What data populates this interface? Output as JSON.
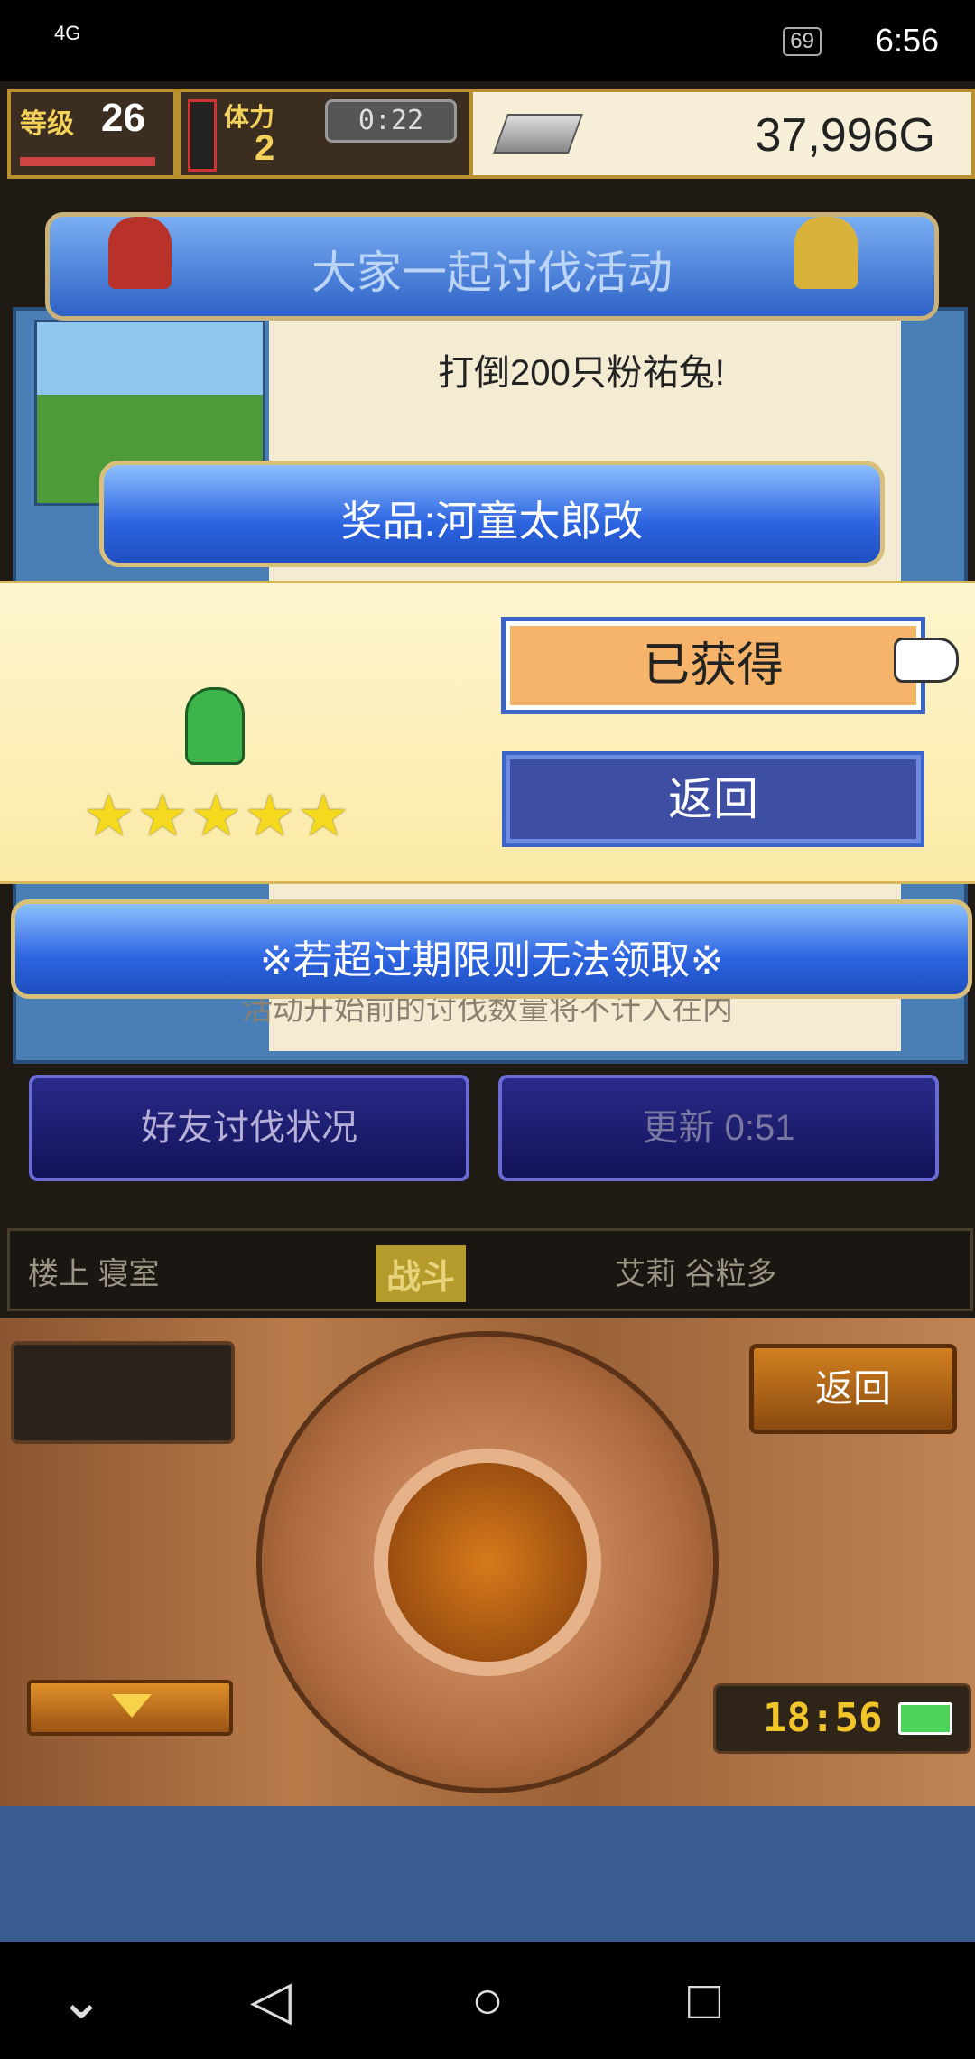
{
  "status_bar": {
    "network": "4G",
    "battery": "69",
    "time": "6:56"
  },
  "hud": {
    "level_label": "等级",
    "level": "26",
    "stamina_label": "体力",
    "stamina": "2",
    "stamina_timer": "0:22",
    "gold": "37,996G"
  },
  "event": {
    "banner_title": "大家一起讨伐活动",
    "task_title": "打倒200只粉祐兔!",
    "behind_note": "活动开始前的讨伐数量将不计入在内"
  },
  "prize_dialog": {
    "title": "奖品:河童太郎改",
    "stars": "★★★★★",
    "rating": 5,
    "obtained_button": "已获得",
    "back_button": "返回"
  },
  "expiry_notice": "※若超过期限则无法领取※",
  "buttons": {
    "friend_status": "好友讨伐状况",
    "refresh": "更新 0:51"
  },
  "location": {
    "place": "楼上 寝室",
    "mode": "战斗",
    "party": "艾莉 谷粒多"
  },
  "controller": {
    "back": "返回",
    "clock": "18:56"
  },
  "nav": {
    "back_icon": "◁",
    "home_icon": "○",
    "recents_icon": "□",
    "down_icon": "⌄"
  }
}
